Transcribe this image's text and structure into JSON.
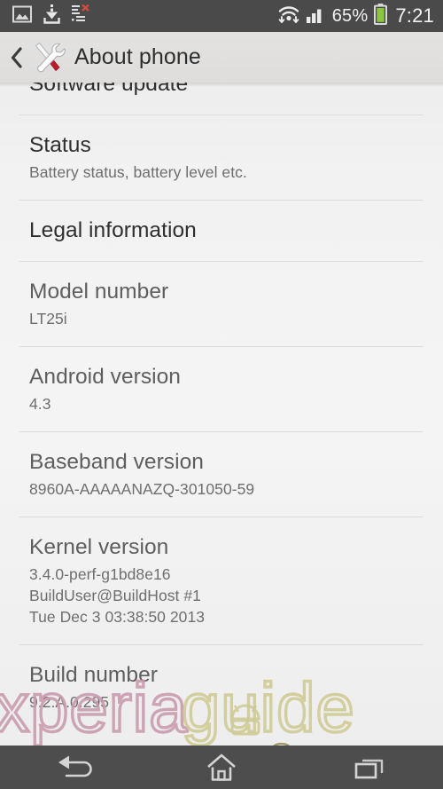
{
  "status_bar": {
    "left_icons": [
      {
        "name": "image-icon",
        "label": "Screenshot captured"
      },
      {
        "name": "download-icon",
        "label": "Download complete"
      },
      {
        "name": "list-error-icon",
        "label": "Sync error"
      }
    ],
    "wifi_icon": "wifi-icon",
    "signal_icon": "cellular-signal-icon",
    "battery_percent": "65%",
    "battery_icon": "battery-icon",
    "battery_color": "#8cc63e",
    "clock": "7:21"
  },
  "action_bar": {
    "back_icon": "back-chevron-icon",
    "app_icon": "tools-icon",
    "title": "About phone"
  },
  "list": {
    "items": [
      {
        "name": "software-update",
        "title": "Software update",
        "sublines": [],
        "interactable": true,
        "muted": false,
        "clipped": true
      },
      {
        "name": "status",
        "title": "Status",
        "sublines": [
          "Battery status, battery level etc."
        ],
        "interactable": true,
        "muted": false
      },
      {
        "name": "legal-information",
        "title": "Legal information",
        "sublines": [],
        "interactable": true,
        "muted": false
      },
      {
        "name": "model-number",
        "title": "Model number",
        "sublines": [
          "LT25i"
        ],
        "interactable": false,
        "muted": true
      },
      {
        "name": "android-version",
        "title": "Android version",
        "sublines": [
          "4.3"
        ],
        "interactable": false,
        "muted": true
      },
      {
        "name": "baseband-version",
        "title": "Baseband version",
        "sublines": [
          "8960A-AAAAANAZQ-301050-59"
        ],
        "interactable": false,
        "muted": true
      },
      {
        "name": "kernel-version",
        "title": "Kernel version",
        "sublines": [
          "3.4.0-perf-g1bd8e16",
          "BuildUser@BuildHost #1",
          "Tue Dec 3 03:38:50 2013"
        ],
        "interactable": false,
        "muted": true
      },
      {
        "name": "build-number",
        "title": "Build number",
        "sublines": [
          "9.2.A.0.295"
        ],
        "interactable": false,
        "muted": true
      }
    ]
  },
  "watermark": {
    "part1": "xperia",
    "part2": "guide",
    "part3": ".Com",
    "color1": "#c89aae",
    "color2": "#cfcb96"
  },
  "nav_bar": {
    "back": "back-nav-icon",
    "home": "home-nav-icon",
    "recents": "recents-nav-icon"
  }
}
